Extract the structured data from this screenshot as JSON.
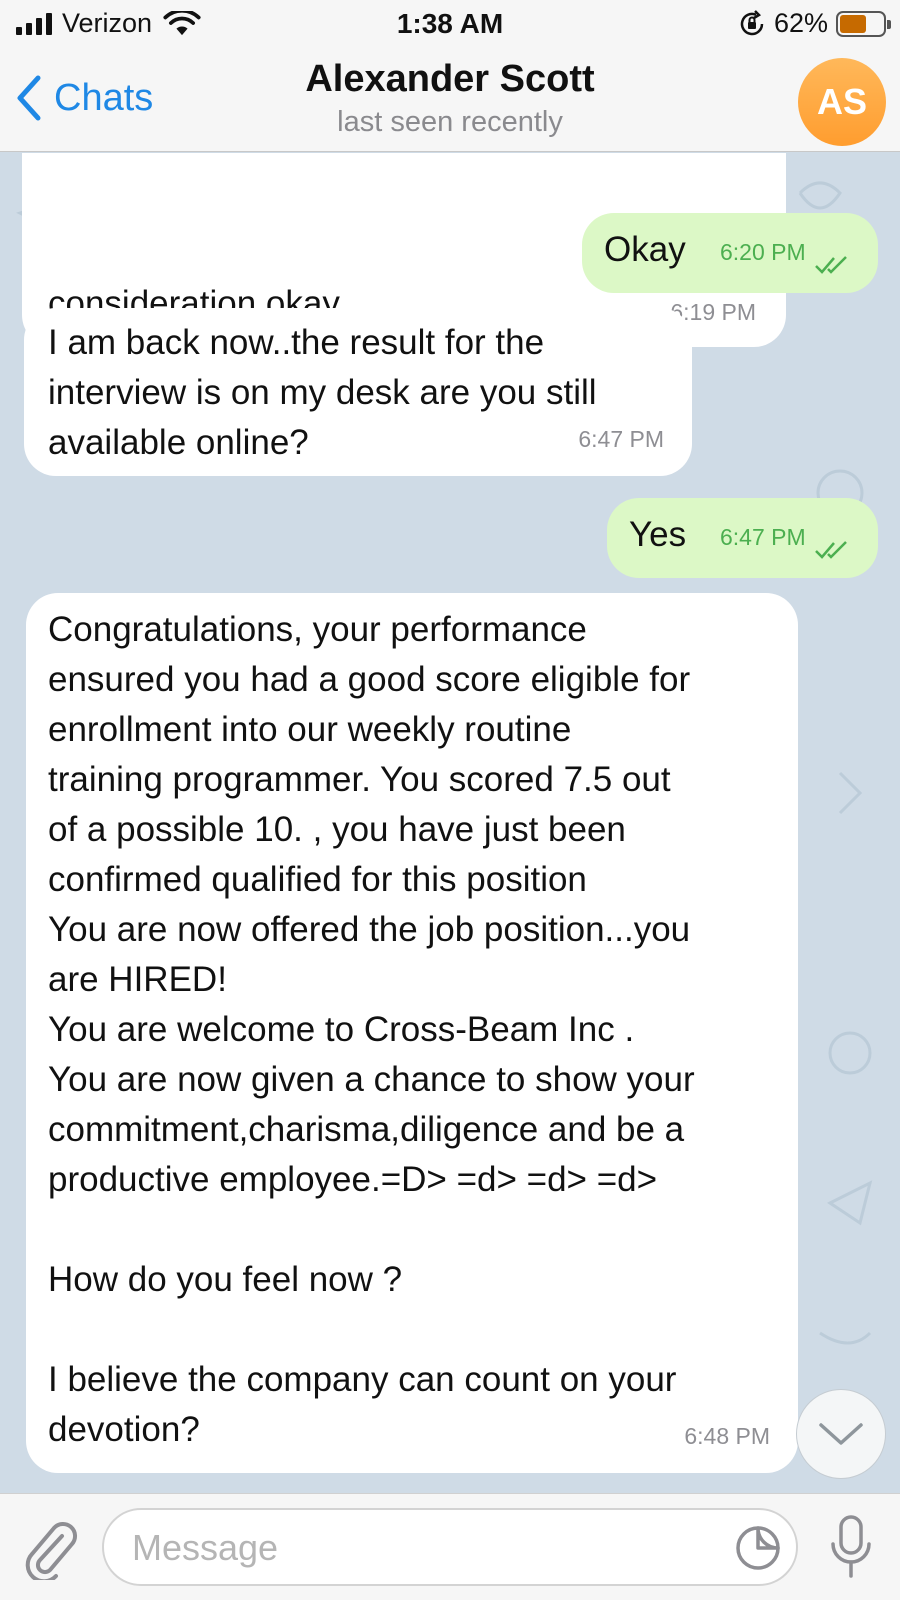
{
  "status_bar": {
    "carrier": "Verizon",
    "time": "1:38 AM",
    "battery_percent": "62%",
    "battery_level": 0.62,
    "icons": [
      "signal-icon",
      "wifi-icon",
      "orientation-lock-icon",
      "battery-icon"
    ]
  },
  "header": {
    "back_label": "Chats",
    "contact_name": "Alexander Scott",
    "contact_status": "last seen recently",
    "avatar_initials": "AS",
    "avatar_color": "#ff9d2f"
  },
  "messages": [
    {
      "direction": "incoming",
      "text": "consideration okay.",
      "time": "6:19 PM"
    },
    {
      "direction": "outgoing",
      "text": "Okay",
      "time": "6:20 PM",
      "status": "read"
    },
    {
      "direction": "incoming",
      "text": "I am back now..the result for the\ninterview is on my desk are you still\navailable online?",
      "time": "6:47 PM"
    },
    {
      "direction": "outgoing",
      "text": "Yes",
      "time": "6:47 PM",
      "status": "read"
    },
    {
      "direction": "incoming",
      "text": "Congratulations, your performance\nensured you had a good score eligible for\nenrollment into our weekly routine\ntraining programmer. You scored 7.5 out\nof a possible 10. , you have just been\nconfirmed qualified for this position\nYou are now offered the job position...you\nare HIRED!\nYou are welcome to Cross-Beam Inc .\nYou are now given a chance to show your\ncommitment,charisma,diligence and be a\nproductive employee.=D> =d> =d> =d>\n\nHow do you feel now ?\n\nI believe the company can count on your\ndevotion?",
      "time": "6:48 PM"
    }
  ],
  "input_bar": {
    "placeholder": "Message",
    "value": ""
  },
  "colors": {
    "accent": "#1f88e5",
    "outgoing_bubble": "#dcf8c6",
    "incoming_bubble": "#ffffff",
    "chat_background": "#cfdbe6",
    "read_ticks": "#4caf50"
  }
}
